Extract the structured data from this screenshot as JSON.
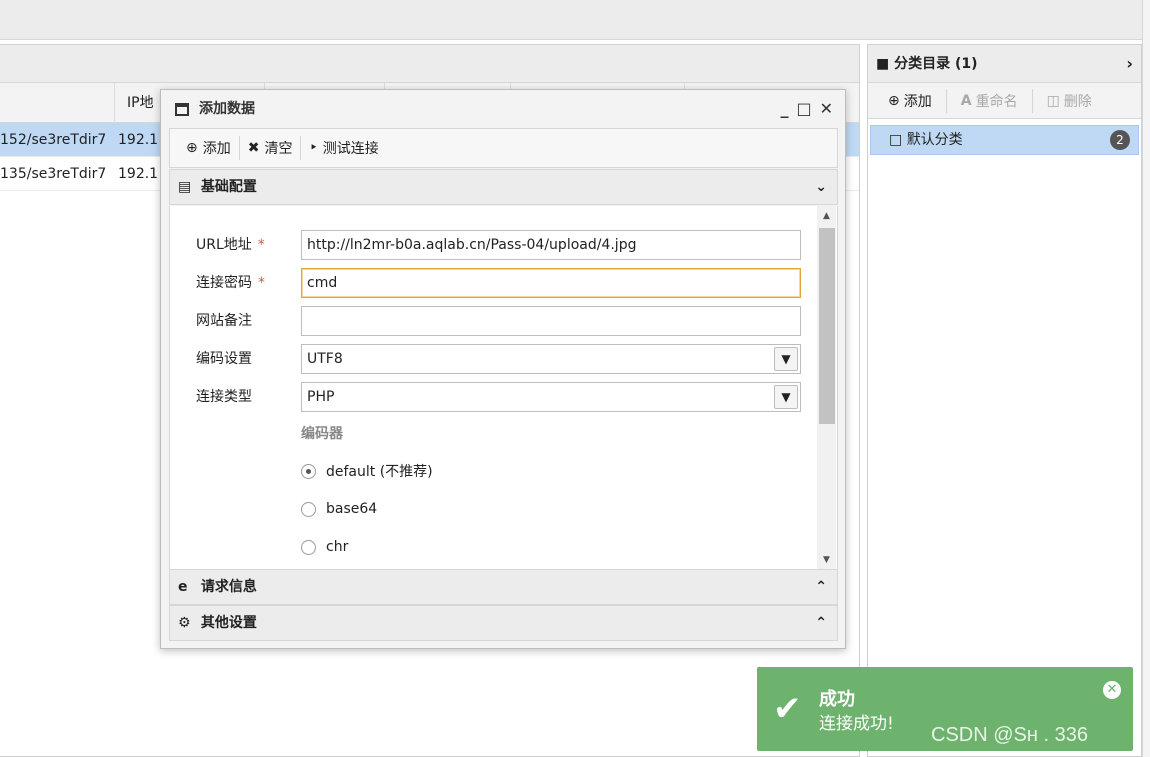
{
  "grid": {
    "header_ip": "IP地",
    "rows": [
      {
        "url": "152/se3reTdir7",
        "ip": "192.1"
      },
      {
        "url": "135/se3reTdir7",
        "ip": "192.1"
      }
    ]
  },
  "category": {
    "title": "分类目录 (1)",
    "toolbar": {
      "add": "添加",
      "rename": "重命名",
      "delete": "删除"
    },
    "items": [
      {
        "label": "默认分类",
        "count": "2"
      }
    ]
  },
  "modal": {
    "title": "添加数据",
    "toolbar": {
      "add": "添加",
      "clear": "清空",
      "test": "测试连接"
    },
    "sections": {
      "basic": "基础配置",
      "request": "请求信息",
      "other": "其他设置"
    },
    "fields": {
      "url_label": "URL地址",
      "url_value": "http://ln2mr-b0a.aqlab.cn/Pass-04/upload/4.jpg",
      "pwd_label": "连接密码",
      "pwd_value": "cmd",
      "note_label": "网站备注",
      "note_value": "",
      "encoding_label": "编码设置",
      "encoding_value": "UTF8",
      "type_label": "连接类型",
      "type_value": "PHP",
      "required_mark": "*"
    },
    "encoder": {
      "label": "编码器",
      "options": [
        {
          "label": "default (不推荐)",
          "selected": true
        },
        {
          "label": "base64",
          "selected": false
        },
        {
          "label": "chr",
          "selected": false
        }
      ]
    }
  },
  "toast": {
    "title": "成功",
    "message": "连接成功!",
    "color": "#6db36d"
  },
  "watermark": "CSDN @Sʜ    . 336"
}
